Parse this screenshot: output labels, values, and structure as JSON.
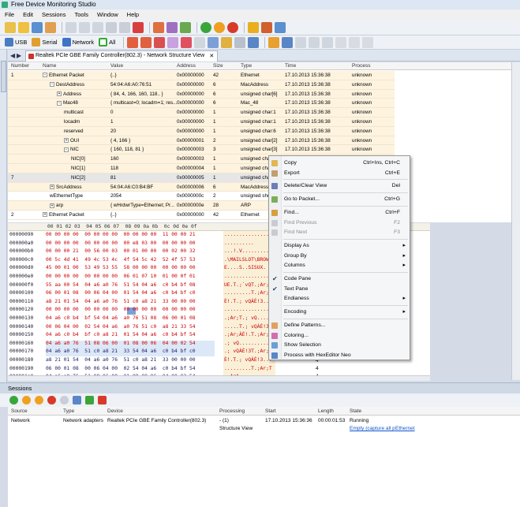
{
  "window": {
    "title": "Free Device Monitoring Studio"
  },
  "menu": [
    "File",
    "Edit",
    "Sessions",
    "Tools",
    "Window",
    "Help"
  ],
  "toolbar2": {
    "usb": "USB",
    "serial": "Serial",
    "network": "Network",
    "all": "All"
  },
  "doc_tab": {
    "title": "Realtek PCIe GBE Family Controller(802.3) - Network Structure View"
  },
  "side_tab": "Network",
  "tree": {
    "columns": [
      "Number",
      "Name",
      "Value",
      "Address",
      "Size",
      "Type",
      "Time",
      "Process"
    ],
    "rows": [
      {
        "number": "1",
        "name": "Ethernet Packet",
        "value": "{..}",
        "address": "0x00000000",
        "size": "42",
        "type": "Ethernet",
        "time": "17.10.2013 15:36:38",
        "process": "unknown"
      },
      {
        "number": "",
        "name": "DestAddress",
        "value": "54:04:A6:A0:76:51",
        "address": "0x00000000",
        "size": "6",
        "type": "MacAddress",
        "time": "17.10.2013 15:36:38",
        "process": "unknown"
      },
      {
        "number": "",
        "name": "Address",
        "value": "{ 84, 4, 166, 160, 118.. }",
        "address": "0x00000000",
        "size": "6",
        "type": "unsigned char[6]",
        "time": "17.10.2013 15:36:38",
        "process": "unknown"
      },
      {
        "number": "",
        "name": "Mac48",
        "value": "{ multicast=0; locadm=1; res...",
        "address": "0x00000000",
        "size": "6",
        "type": "Mac_48",
        "time": "17.10.2013 15:36:38",
        "process": "unknown"
      },
      {
        "number": "",
        "name": "multicast",
        "value": "0",
        "address": "0x00000000",
        "size": "1",
        "type": "unsigned char:1",
        "time": "17.10.2013 15:36:38",
        "process": "unknown"
      },
      {
        "number": "",
        "name": "locadm",
        "value": "1",
        "address": "0x00000000",
        "size": "1",
        "type": "unsigned char:1",
        "time": "17.10.2013 15:36:38",
        "process": "unknown"
      },
      {
        "number": "",
        "name": "reserved",
        "value": "20",
        "address": "0x00000000",
        "size": "1",
        "type": "unsigned char:6",
        "time": "17.10.2013 15:36:38",
        "process": "unknown"
      },
      {
        "number": "",
        "name": "OUI",
        "value": "{ 4, 166 }",
        "address": "0x00000001",
        "size": "2",
        "type": "unsigned char[2]",
        "time": "17.10.2013 15:36:38",
        "process": "unknown"
      },
      {
        "number": "",
        "name": "NIC",
        "value": "{ 160, 118, 81 }",
        "address": "0x00000003",
        "size": "3",
        "type": "unsigned char[3]",
        "time": "17.10.2013 15:36:38",
        "process": "unknown"
      },
      {
        "number": "",
        "name": "NIC[0]",
        "value": "160",
        "address": "0x00000003",
        "size": "1",
        "type": "unsigned cha",
        "time": "",
        "process": ""
      },
      {
        "number": "",
        "name": "NIC[1]",
        "value": "118",
        "address": "0x00000004",
        "size": "1",
        "type": "unsigned cha",
        "time": "",
        "process": ""
      },
      {
        "number": "7",
        "name": "NIC[2]",
        "value": "81",
        "address": "0x00000005",
        "size": "1",
        "type": "unsigned cha",
        "time": "",
        "process": ""
      },
      {
        "number": "",
        "name": "SrcAddress",
        "value": "54:04:A6:C0:B4:BF",
        "address": "0x00000006",
        "size": "6",
        "type": "MacAddress",
        "time": "",
        "process": ""
      },
      {
        "number": "",
        "name": "wEthernetType",
        "value": "2054",
        "address": "0x0000000c",
        "size": "2",
        "type": "unsigned sho",
        "time": "",
        "process": ""
      },
      {
        "number": "",
        "name": "arp",
        "value": "{ wHrdwrType=Ethernet; Pr...",
        "address": "0x0000000e",
        "size": "28",
        "type": "ARP",
        "time": "",
        "process": ""
      },
      {
        "number": "2",
        "name": "Ethernet Packet",
        "value": "{..}",
        "address": "0x00000000",
        "size": "42",
        "type": "Ethernet",
        "time": "",
        "process": ""
      }
    ]
  },
  "hex": {
    "header": "00 01 02 03  04 05 06 07  08 09 0a 0b  0c 0d 0e 0f",
    "rows": [
      {
        "off": "00000090",
        "hex": "00 00 00 00  00 00 00 00  00 00 00 00  11 00 00 21",
        "asc": "...............!"
      },
      {
        "off": "000000a0",
        "hex": "00 00 00 00  00 00 00 00  00 e8 03 00  00 00 00 00",
        "asc": ".........."
      },
      {
        "off": "000000b0",
        "hex": "00 00 00 21  00 56 00 03  00 01 00 00  00 02 00 32",
        "asc": "...!.V.........2"
      },
      {
        "off": "000000c0",
        "hex": "00 5c 4d 41  49 4c 53 4c  4f 54 5c 42  52 4f 57 53",
        "asc": ".\\MAILSLOT\\BROWS"
      },
      {
        "off": "000000d0",
        "hex": "45 00 01 00  53 49 53 55  58 00 00 00  00 00 00 00",
        "asc": "E....S..SISUX."
      },
      {
        "off": "000000e0",
        "hex": "00 00 00 00  00 00 00 00  06 01 07 10  01 00 0f 01",
        "asc": "................"
      },
      {
        "off": "000000f0",
        "hex": "55 aa 00 54  04 a6 a0 76  51 54 04 a6  c0 b4 bf 08",
        "asc": "UE.T.;`vQT.;Ar;."
      },
      {
        "off": "00000100",
        "hex": "06 00 01 08  00 06 04 00  01 54 04 a6  c0 b4 bf c0",
        "asc": ".........T.;Ar;."
      },
      {
        "off": "00000110",
        "hex": "a8 21 01 54  04 a6 a0 76  51 c0 a8 21  33 00 00 00",
        "asc": "È!.T.; vQÀÈ!3..."
      },
      {
        "off": "00000120",
        "hex": "00 00 00 00  00 00 00 00  00 00 00 00  00 00 00 00",
        "asc": "................"
      },
      {
        "off": "00000130",
        "hex": "04 a6 c0 b4  bf 54 04 a6  a0 76 51 08  06 00 01 08",
        "asc": ".;Ar;T.; vQ....."
      },
      {
        "off": "00000140",
        "hex": "00 06 04 00  02 54 04 a6  a0 76 51 c0  a8 21 33 54",
        "asc": ".....T.; vQÀÈ!3T"
      },
      {
        "off": "00000150",
        "hex": "04 a6 c0 b4  bf c0 a8 21  01 54 04 a6  c0 b4 bf 54",
        "asc": ".;Ar;ÀÈ!.T.;Ar;T"
      },
      {
        "off": "00000160",
        "hex": "04 a6 a0 76  51 08 06 00  01 08 00 06  04 00 02 54",
        "asc": ".; vQ..........T"
      },
      {
        "off": "00000170",
        "hex": "04 a6 a0 76  51 c0 a8 21  33 54 04 a6  c0 b4 bf c0",
        "asc": ".; vQÀÈ!3T.;Ar;À"
      },
      {
        "off": "00000180",
        "hex": "a8 21 01 54  04 a6 a0 76  51 c0 a8 21  33 00 00 00",
        "asc": "È!.T.; vQÀÈ!3..."
      },
      {
        "off": "00000190",
        "hex": "06 00 01 08  00 06 04 00  02 54 04 a6  c0 b4 bf 54",
        "asc": ".........T.;Ar;T"
      },
      {
        "off": "000001a0",
        "hex": "04 a6 a0 76  51 08 06 00  01 08 00 06  04 00 02 54",
        "asc": ".;ArA"
      }
    ],
    "side_sizes": [
      "4",
      "4",
      "4"
    ]
  },
  "sessions": {
    "panel_title": "Sessions",
    "columns": [
      "Source",
      "Type",
      "Device",
      "Processing",
      "Start",
      "Length",
      "State"
    ],
    "row": {
      "source": "Network",
      "type": "Network adapters",
      "device": "Realtek PCIe GBE Family Controller(802.3)",
      "processing": "- (1)",
      "start": "17.10.2013 15:36:36",
      "length": "00:00:01:53",
      "state": "Running"
    },
    "subrow": {
      "processing": "Structure View",
      "state_link1": "Empty (capture all p",
      "state_link2": "Ethernet"
    }
  },
  "context_menu": {
    "items": [
      {
        "label": "Copy",
        "shortcut": "Ctrl+Ins, Ctrl+C",
        "icon": "copy-icon"
      },
      {
        "label": "Export",
        "shortcut": "Ctrl+E",
        "icon": "export-icon"
      },
      {
        "label": "Delete/Clear View",
        "shortcut": "Del",
        "icon": "delete-icon"
      },
      {
        "label": "Go to Packet...",
        "shortcut": "Ctrl+G",
        "icon": "goto-icon"
      },
      {
        "label": "Find...",
        "shortcut": "Ctrl+F",
        "icon": "find-icon"
      },
      {
        "label": "Find Previous",
        "shortcut": "F2",
        "icon": "find-prev-icon"
      },
      {
        "label": "Find Next",
        "shortcut": "F3",
        "icon": "find-next-icon"
      },
      {
        "label": "Display As",
        "shortcut": "",
        "icon": ""
      },
      {
        "label": "Group By",
        "shortcut": "",
        "icon": ""
      },
      {
        "label": "Columns",
        "shortcut": "",
        "icon": ""
      },
      {
        "label": "Code Pane",
        "shortcut": "",
        "icon": ""
      },
      {
        "label": "Text Pane",
        "shortcut": "",
        "icon": ""
      },
      {
        "label": "Endianess",
        "shortcut": "",
        "icon": ""
      },
      {
        "label": "Encoding",
        "shortcut": "",
        "icon": ""
      },
      {
        "label": "Define Patterns...",
        "shortcut": "",
        "icon": "patterns-icon"
      },
      {
        "label": "Coloring...",
        "shortcut": "",
        "icon": "coloring-icon"
      },
      {
        "label": "Show Selection",
        "shortcut": "",
        "icon": "selection-icon"
      },
      {
        "label": "Process with HexEditor Neo",
        "shortcut": "",
        "icon": "hexeditor-icon"
      }
    ]
  }
}
